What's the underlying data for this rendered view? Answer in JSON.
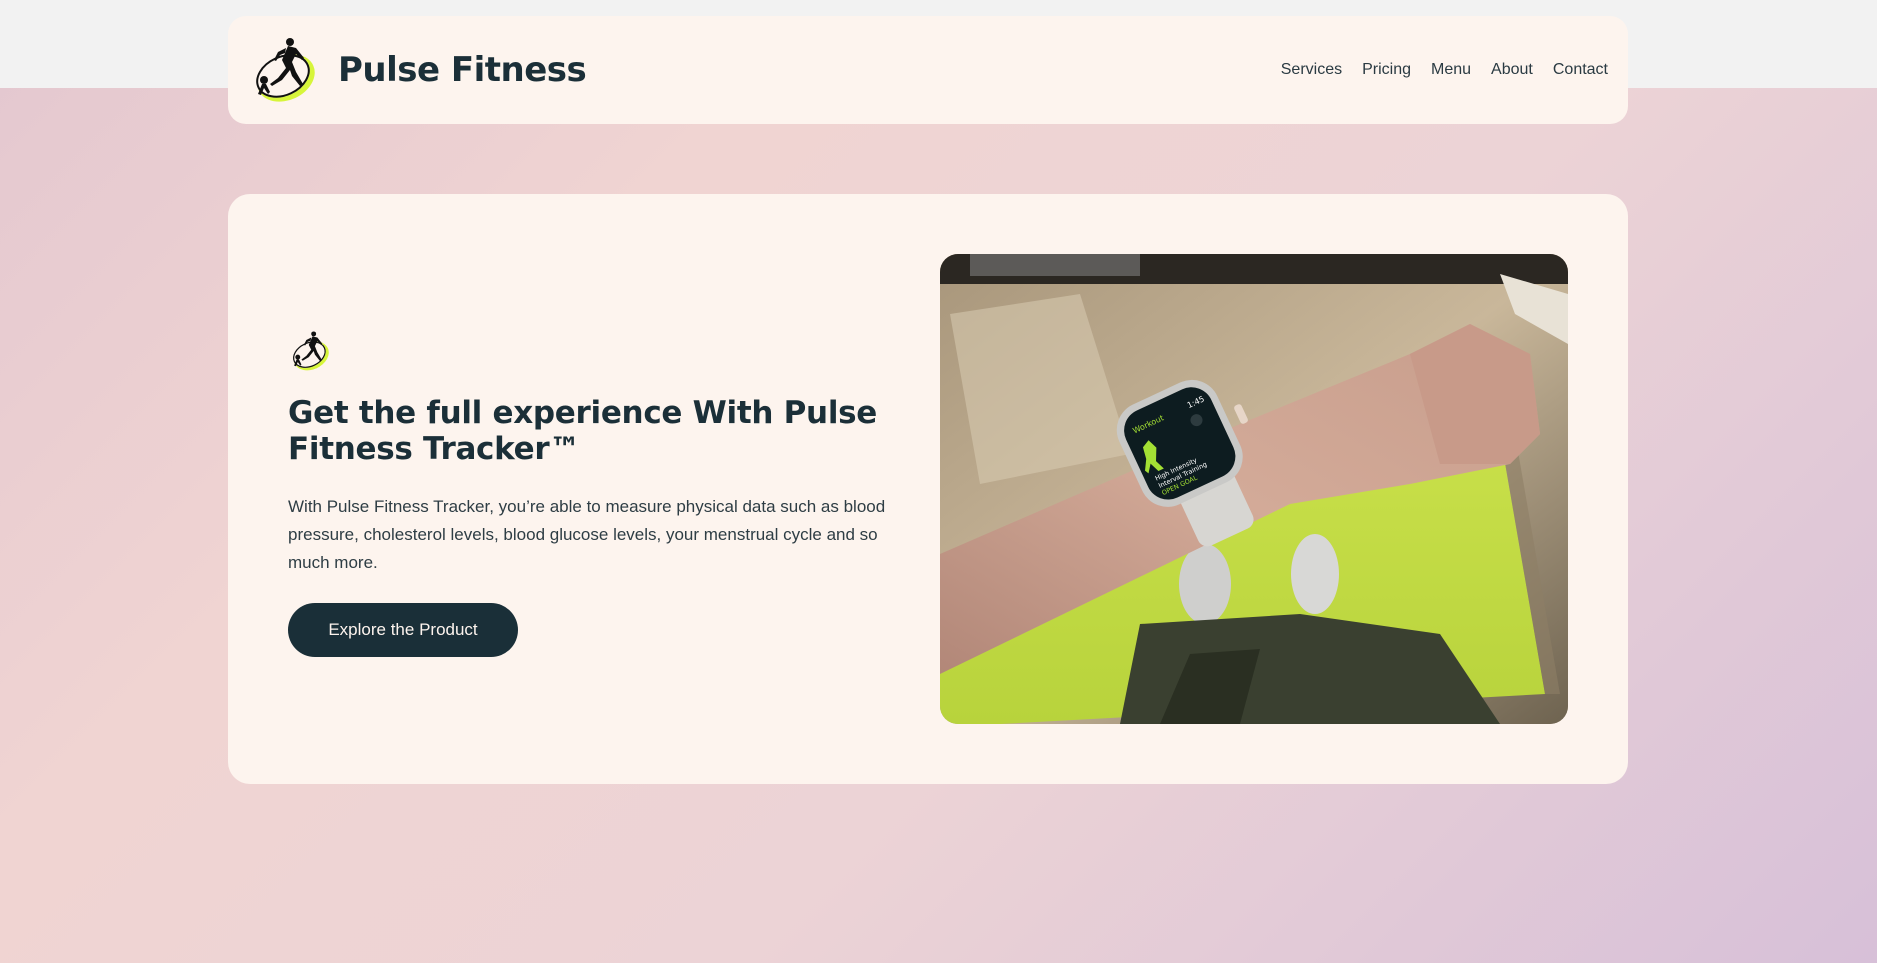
{
  "header": {
    "brand": "Pulse Fitness",
    "nav": [
      "Services",
      "Pricing",
      "Menu",
      "About",
      "Contact"
    ]
  },
  "hero": {
    "title": "Get the full experience With Pulse Fitness Tracker™",
    "description": "With Pulse Fitness Tracker, you’re able to measure physical data such as blood pressure, cholesterol levels, blood glucose levels, your menstrual cycle and so much more.",
    "cta_label": "Explore the Product",
    "watch": {
      "app_label": "Workout",
      "time": "1:45",
      "line1": "High Intensity",
      "line2": "Interval Training",
      "line3": "OPEN GOAL"
    }
  },
  "icons": {
    "logo": "running-woman-logo-icon",
    "hero_logo": "running-woman-logo-icon"
  },
  "colors": {
    "accent": "#d7f53a",
    "dark": "#1a2f38",
    "card": "#fdf4ee"
  }
}
